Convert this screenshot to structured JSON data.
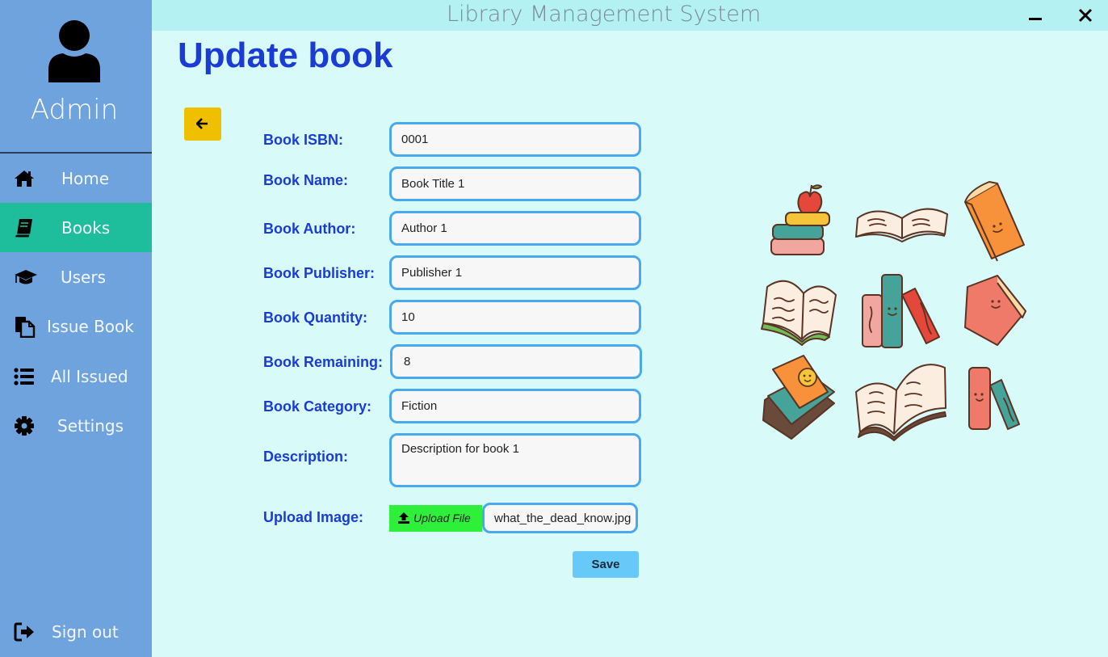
{
  "app": {
    "title": "Library Management System"
  },
  "user": {
    "name": "Admin"
  },
  "sidebar": {
    "items": [
      {
        "label": "Home",
        "icon": "home-icon"
      },
      {
        "label": "Books",
        "icon": "book-icon",
        "active": true
      },
      {
        "label": "Users",
        "icon": "graduation-cap-icon"
      },
      {
        "label": "Issue Book",
        "icon": "copy-document-icon"
      },
      {
        "label": "All Issued",
        "icon": "list-icon"
      },
      {
        "label": "Settings",
        "icon": "gear-icon"
      }
    ],
    "signout": {
      "label": "Sign out",
      "icon": "sign-out-icon"
    }
  },
  "page": {
    "title": "Update book"
  },
  "form": {
    "isbn": {
      "label": "Book ISBN:",
      "value": "0001"
    },
    "name": {
      "label": "Book Name:",
      "value": "Book Title 1"
    },
    "author": {
      "label": "Book Author:",
      "value": "Author 1"
    },
    "publisher": {
      "label": "Book Publisher:",
      "value": "Publisher 1"
    },
    "quantity": {
      "label": "Book Quantity:",
      "value": "10"
    },
    "remaining": {
      "label": "Book Remaining:",
      "value": "8"
    },
    "category": {
      "label": "Book Category:",
      "value": "Fiction"
    },
    "description": {
      "label": "Description:",
      "value": "Description for book 1"
    },
    "image": {
      "label": "Upload Image:",
      "button_label": "Upload File",
      "filename": "what_the_dead_know.jpg"
    },
    "save_label": "Save"
  },
  "colors": {
    "sidebar": "#6ea3dd",
    "active": "#1ebd9c",
    "background": "#d8fbfa",
    "titlebar": "#b3f1f3",
    "accent_text": "#1a3bd4",
    "input_border": "#48a8f0",
    "back_button": "#f0c000",
    "upload_button": "#2ef03a",
    "save_button": "#66c9f7"
  }
}
